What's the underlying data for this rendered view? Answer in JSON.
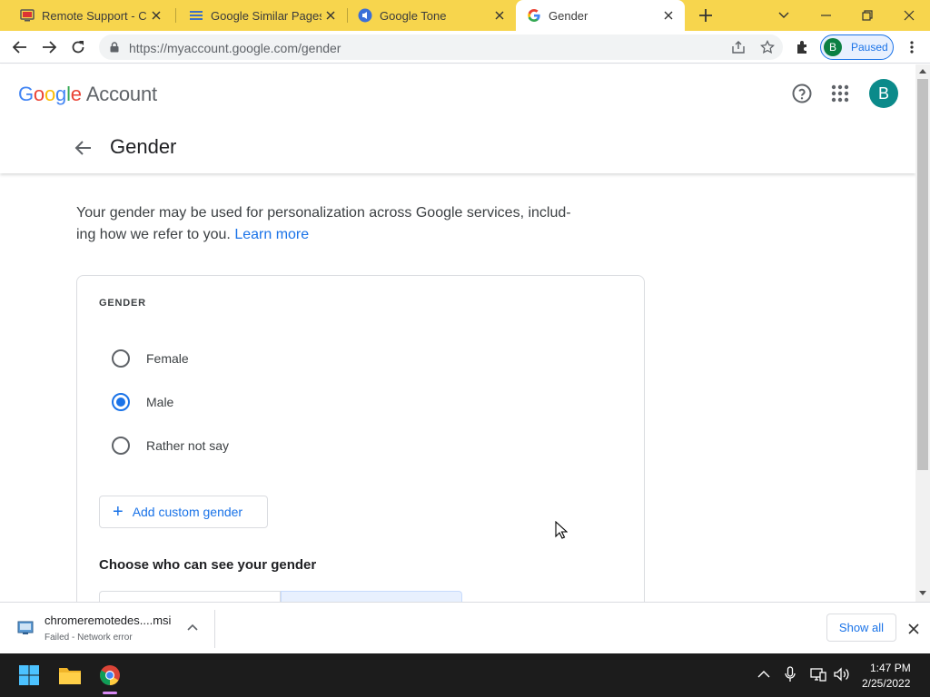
{
  "browser": {
    "tabs": [
      {
        "title": "Remote Support - Chro",
        "icon": "remote-desktop-icon"
      },
      {
        "title": "Google Similar Pages",
        "icon": "similar-pages-icon"
      },
      {
        "title": "Google Tone",
        "icon": "google-tone-icon"
      },
      {
        "title": "Gender",
        "icon": "google-g-icon",
        "active": true
      }
    ],
    "url": "https://myaccount.google.com/gender",
    "profile_chip": {
      "initial": "B",
      "label": "Paused"
    },
    "tabstrip_color": "#f7d54d"
  },
  "header": {
    "logo_account": "Account",
    "avatar_initial": "B"
  },
  "page": {
    "title": "Gender",
    "description": "Your gender may be used for personalization across Google services, includ-ing how we refer to you.",
    "learn_more": "Learn more",
    "card": {
      "label": "GENDER",
      "options": [
        {
          "label": "Female",
          "checked": false
        },
        {
          "label": "Male",
          "checked": true
        },
        {
          "label": "Rather not say",
          "checked": false
        }
      ],
      "add_custom": "Add custom gender",
      "visibility_heading": "Choose who can see your gender"
    }
  },
  "downloads": {
    "file_name": "chromeremotedes....msi",
    "status": "Failed - Network error",
    "show_all": "Show all"
  },
  "taskbar": {
    "time": "1:47 PM",
    "date": "2/25/2022"
  },
  "colors": {
    "accent": "#1a73e8",
    "avatar": "#0b8a8a"
  }
}
